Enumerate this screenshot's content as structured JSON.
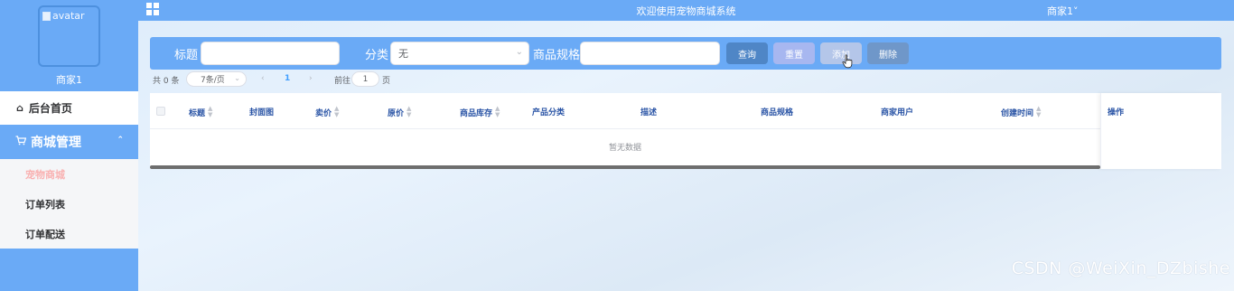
{
  "sidebar": {
    "avatar_alt": "avatar",
    "merchant_name": "商家1",
    "home_label": "后台首页",
    "shop_menu_label": "商城管理",
    "submenu": [
      {
        "label": "宠物商城"
      },
      {
        "label": "订单列表"
      },
      {
        "label": "订单配送"
      }
    ]
  },
  "topbar": {
    "welcome": "欢迎使用宠物商城系统",
    "user": "商家1"
  },
  "search": {
    "title_label": "标题",
    "title_value": "",
    "category_label": "分类",
    "category_value": "无",
    "spec_label": "商品规格",
    "spec_value": "",
    "query_button": "查询",
    "reset_button": "重置",
    "add_button": "添加",
    "delete_button": "删除"
  },
  "pagination": {
    "total": "共 0 条",
    "page_size": "7条/页",
    "current_page": "1",
    "goto_label": "前往",
    "jump_value": "1",
    "page_suffix": "页"
  },
  "table": {
    "columns": [
      "标题",
      "封面图",
      "卖价",
      "原价",
      "商品库存",
      "产品分类",
      "描述",
      "商品规格",
      "商家用户",
      "创建时间",
      "操作"
    ],
    "empty_text": "暂无数据"
  },
  "watermark": "CSDN @WeiXin_DZbishe",
  "colors": {
    "primary": "#6aaaf6",
    "query_button": "#4f86c6",
    "reset_button": "#a7b7f0",
    "add_button": "#b4c6e9",
    "delete_button": "#6f97c9",
    "active_submenu": "#f9b1b1"
  }
}
